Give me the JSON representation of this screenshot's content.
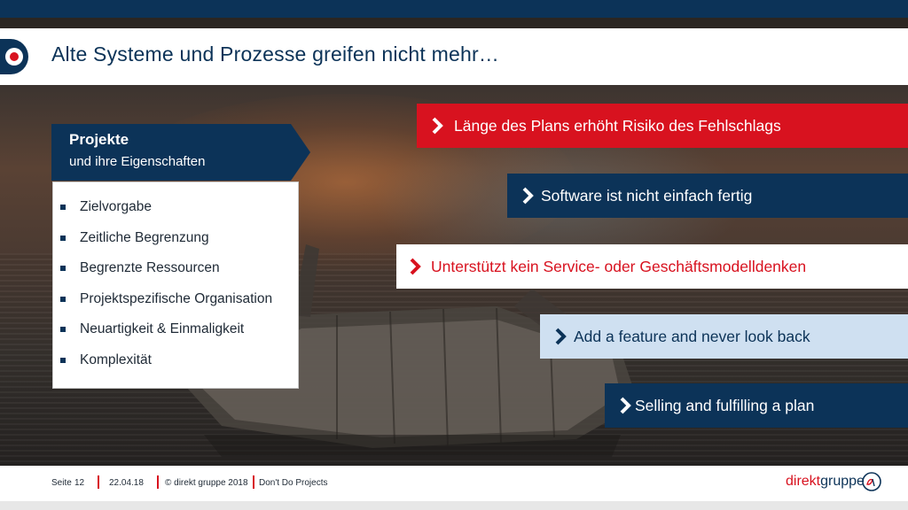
{
  "slide": {
    "title": "Alte Systeme und Prozesse greifen nicht mehr…"
  },
  "projekte": {
    "heading": "Projekte",
    "subheading": "und ihre Eigenschaften",
    "items": [
      "Zielvorgabe",
      "Zeitliche Begrenzung",
      "Begrenzte Ressourcen",
      "Projektspezifische Organisation",
      "Neuartigkeit & Einmaligkeit",
      "Komplexität"
    ]
  },
  "banners": [
    "Länge des Plans erhöht Risiko des Fehlschlags",
    "Software ist nicht einfach fertig",
    "Unterstützt kein Service- oder Geschäftsmodelldenken",
    "Add a feature and never look back",
    "Selling and fulfilling a plan"
  ],
  "footer": {
    "page_label": "Seite",
    "page_number": "12",
    "date": "22.04.18",
    "copyright": "© direkt gruppe 2018",
    "topic": "Don't Do Projects",
    "brand_part1": "direkt",
    "brand_part2": "gruppe"
  },
  "colors": {
    "navy": "#0c3358",
    "red": "#d8121f",
    "light_blue": "#cfe0f1",
    "white": "#ffffff"
  },
  "icons": {
    "bullet": "square-bullet-icon",
    "banner": "chevron-right-icon",
    "logo": "direktgruppe-logo-icon"
  }
}
